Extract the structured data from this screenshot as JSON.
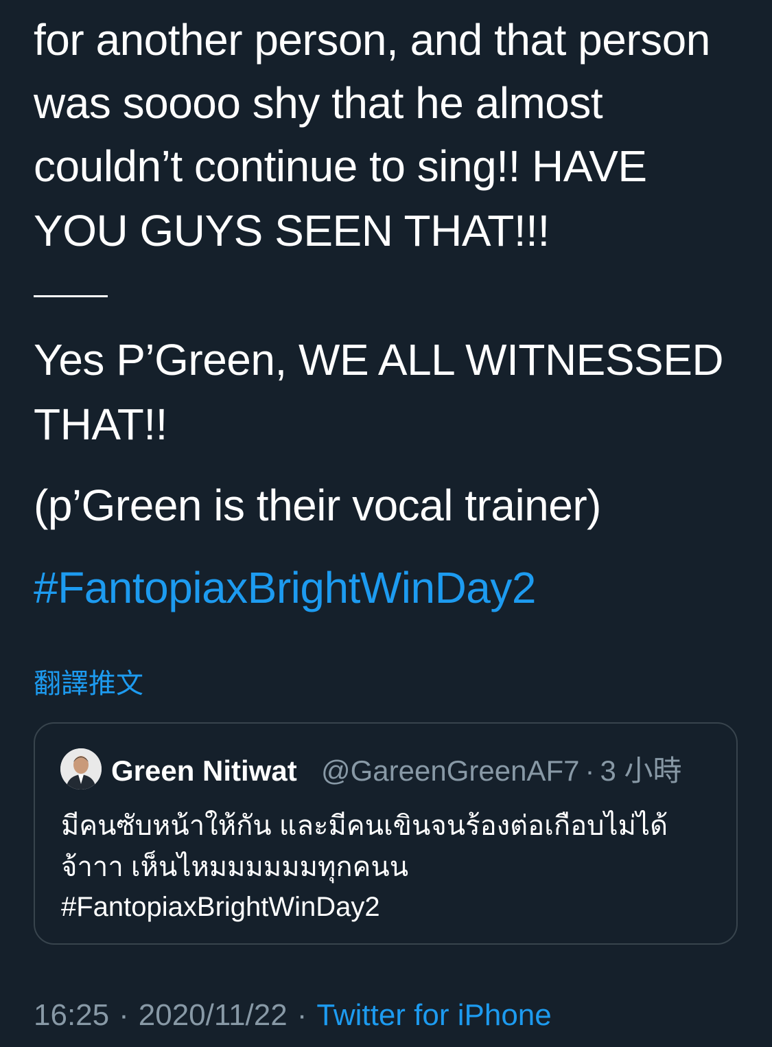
{
  "tweet": {
    "lines": [
      "for another person, and that person",
      "was soooo shy that he almost",
      "couldn’t continue to sing!! HAVE",
      "YOU GUYS SEEN THAT!!!",
      "Yes P’Green, WE ALL WITNESSED",
      "THAT!!",
      "(p’Green is their vocal trainer)"
    ],
    "hashtag": "#FantopiaxBrightWinDay2",
    "translate_label": "翻譯推文"
  },
  "quote": {
    "author_name": "Green Nitiwat",
    "author_handle": "@GareenGreenAF7",
    "separator": "·",
    "time": "3 小時",
    "lines": [
      "มีคนซับหน้าให้กัน และมีคนเขินจนร้องต่อเกือบไม่ได้",
      "จ้าาา เห็นไหมมมมมมทุกคนน",
      "#FantopiaxBrightWinDay2"
    ]
  },
  "meta": {
    "time": "16:25",
    "separator": "·",
    "date": "2020/11/22",
    "source": "Twitter for iPhone"
  },
  "colors": {
    "background": "#15202b",
    "text": "#ffffff",
    "accent": "#1d9bf0",
    "secondary": "#8899a6",
    "border": "#38444d"
  },
  "icons": {
    "avatar": "profile-photo"
  }
}
